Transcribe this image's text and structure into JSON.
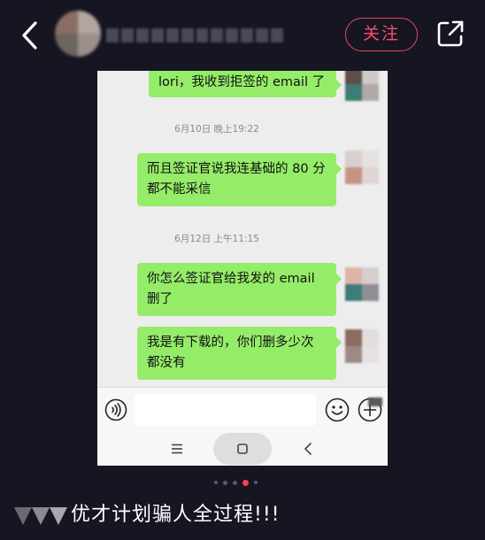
{
  "header": {
    "follow_label": "关注"
  },
  "chat": {
    "messages": [
      {
        "text_lines": [
          "lori，我收到拒签的 email 了"
        ]
      },
      {
        "timestamp": "6月10日 晚上19:22",
        "text_lines": [
          "而且签证官说我连基础的 80 分",
          "都不能采信"
        ]
      },
      {
        "timestamp": "6月12日 上午11:15",
        "text_lines": [
          "你怎么签证官给我发的 email",
          "删了"
        ]
      },
      {
        "text_lines": [
          "我是有下载的，你们删多少次",
          "都没有"
        ]
      }
    ]
  },
  "system_nav": {
    "menu_icon": "≡",
    "home_icon": "▢",
    "back_icon": "‹"
  },
  "pager": {
    "count": 5,
    "active_index": 3
  },
  "caption": {
    "text": "优才计划骗人全过程!!!"
  },
  "colors": {
    "background": "#161622",
    "accent": "#ff4d6a",
    "bubble": "#95ec69"
  }
}
